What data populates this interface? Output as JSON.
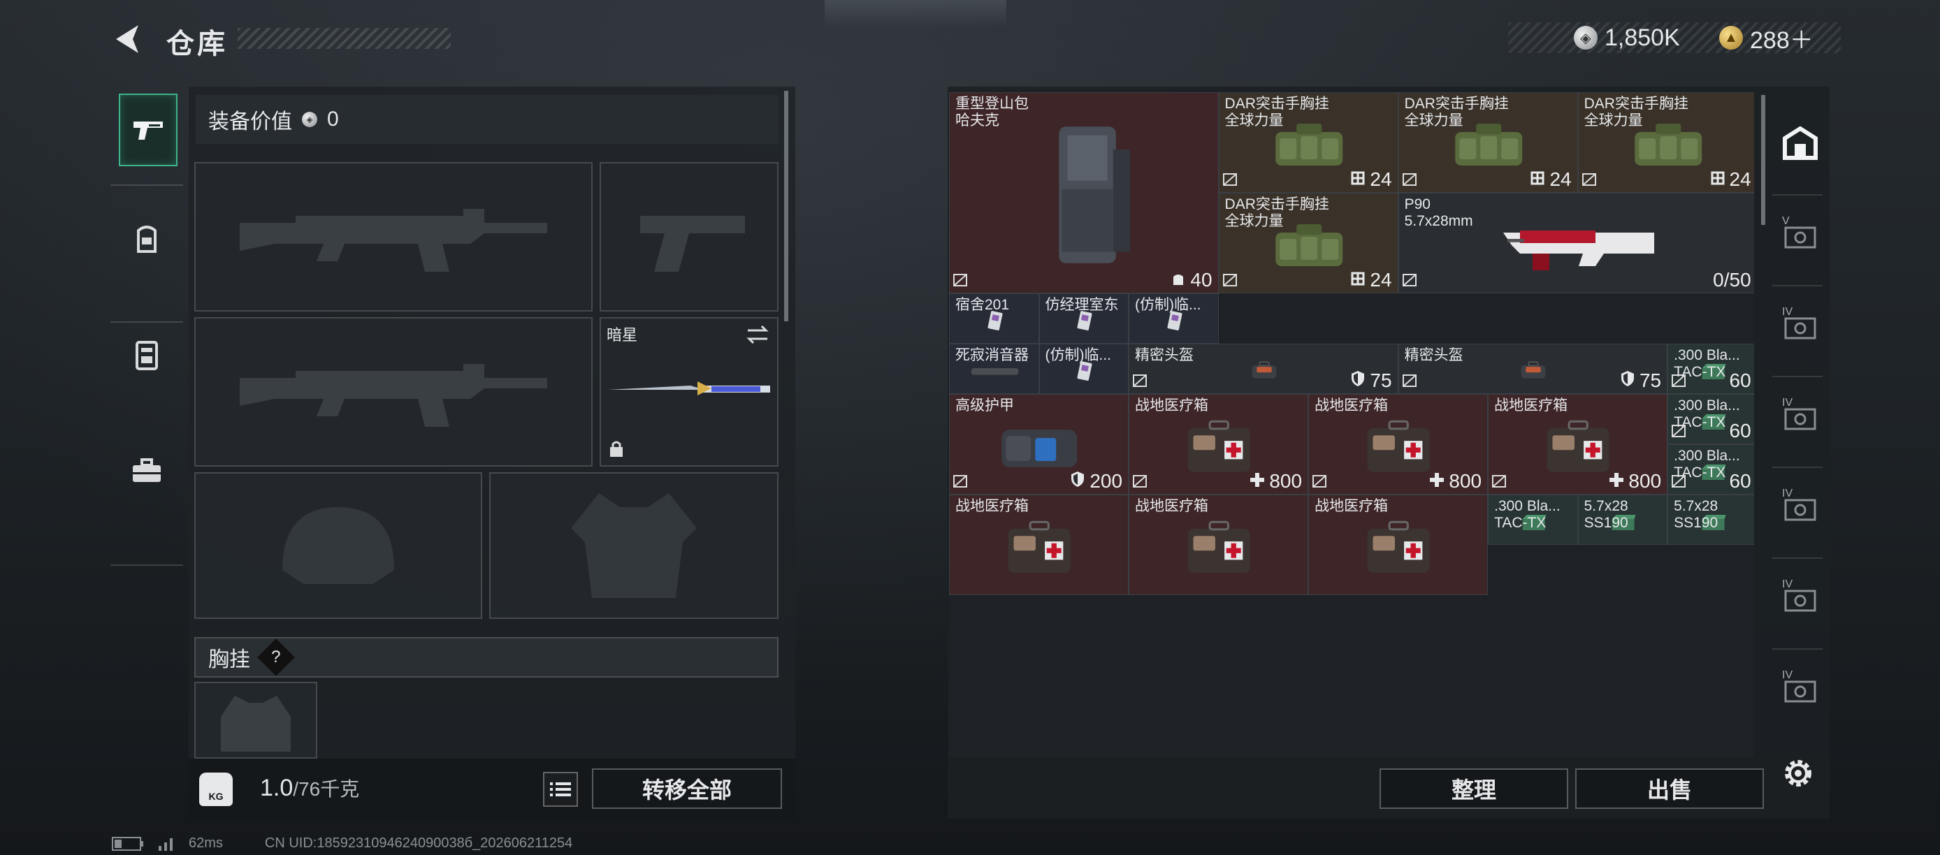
{
  "header": {
    "title": "仓库",
    "currency_a": {
      "icon": "silver-coin-icon",
      "value": "1,850K"
    },
    "currency_b": {
      "icon": "gold-coin-icon",
      "value": "288＋"
    }
  },
  "left_rail": {
    "items": [
      {
        "name": "weapon-tab",
        "icon": "pistol-icon",
        "active": true
      },
      {
        "name": "armor-tab",
        "icon": "backpack-icon",
        "active": false
      },
      {
        "name": "vest-tab",
        "icon": "chest-rig-icon",
        "active": false
      },
      {
        "name": "case-tab",
        "icon": "toolbox-icon",
        "active": false
      }
    ]
  },
  "loadout": {
    "equip_value_label": "装备价值",
    "equip_value": "0",
    "melee_label": "暗星",
    "chest_rig_label": "胸挂",
    "help_mark": "?",
    "weight_icon_text": "KG",
    "weight_value": "1.0",
    "weight_max": "/76千克",
    "transfer_all": "转移全部"
  },
  "stash": {
    "items": [
      {
        "name": "重型登山包\n哈夫克",
        "count": "40",
        "count_icon": "capacity-icon",
        "color": "red"
      },
      {
        "name": "DAR突击手胸挂\n全球力量",
        "count": "24",
        "count_icon": "grid-icon",
        "color": "brown"
      },
      {
        "name": "DAR突击手胸挂\n全球力量",
        "count": "24",
        "count_icon": "grid-icon",
        "color": "brown"
      },
      {
        "name": "DAR突击手胸挂\n全球力量",
        "count": "24",
        "count_icon": "grid-icon",
        "color": "brown"
      },
      {
        "name": "DAR突击手胸挂\n全球力量",
        "count": "24",
        "count_icon": "grid-icon",
        "color": "brown"
      },
      {
        "name": "P90\n5.7x28mm",
        "count": "0/50",
        "count_icon": "",
        "color": "dark"
      },
      {
        "name": "宿舍201",
        "count": "",
        "count_icon": "",
        "color": "blue"
      },
      {
        "name": "仿经理室东",
        "count": "",
        "count_icon": "",
        "color": "blue"
      },
      {
        "name": "(仿制)临...",
        "count": "",
        "count_icon": "",
        "color": "blue"
      },
      {
        "name": "死寂消音器",
        "count": "",
        "count_icon": "",
        "color": "blue"
      },
      {
        "name": "(仿制)临...",
        "count": "",
        "count_icon": "",
        "color": "blue"
      },
      {
        "name": "精密头盔",
        "count": "75",
        "count_icon": "shield-icon",
        "color": "dark"
      },
      {
        "name": "精密头盔",
        "count": "75",
        "count_icon": "shield-icon",
        "color": "dark"
      },
      {
        "name": ".300 Bla...\nTAC-TX",
        "count": "60",
        "count_icon": "",
        "color": "teal"
      },
      {
        "name": "高级护甲",
        "count": "200",
        "count_icon": "shield-icon",
        "color": "red"
      },
      {
        "name": "战地医疗箱",
        "count": "800",
        "count_icon": "plus-icon",
        "color": "red"
      },
      {
        "name": "战地医疗箱",
        "count": "800",
        "count_icon": "plus-icon",
        "color": "red"
      },
      {
        "name": "战地医疗箱",
        "count": "800",
        "count_icon": "plus-icon",
        "color": "red"
      },
      {
        "name": ".300 Bla...\nTAC-TX",
        "count": "60",
        "count_icon": "",
        "color": "teal"
      },
      {
        "name": ".300 Bla...\nTAC-TX",
        "count": "60",
        "count_icon": "",
        "color": "teal"
      },
      {
        "name": "战地医疗箱",
        "count": "",
        "count_icon": "",
        "color": "red"
      },
      {
        "name": "战地医疗箱",
        "count": "",
        "count_icon": "",
        "color": "red"
      },
      {
        "name": "战地医疗箱",
        "count": "",
        "count_icon": "",
        "color": "red"
      },
      {
        "name": ".300 Bla...\nTAC-TX",
        "count": "",
        "count_icon": "",
        "color": "teal"
      },
      {
        "name": "5.7x28\nSS190",
        "count": "",
        "count_icon": "",
        "color": "teal"
      },
      {
        "name": "5.7x28\nSS190",
        "count": "",
        "count_icon": "",
        "color": "teal"
      }
    ],
    "sort_label": "整理",
    "sell_label": "出售"
  },
  "side_tabs": [
    {
      "name": "stash-home-tab",
      "icon": "home-icon",
      "label": ""
    },
    {
      "name": "stash-tab-v",
      "icon": "stash-page-icon",
      "label": "V"
    },
    {
      "name": "stash-tab-iv-1",
      "icon": "stash-page-icon",
      "label": "IV"
    },
    {
      "name": "stash-tab-iv-2",
      "icon": "stash-page-icon",
      "label": "IV"
    },
    {
      "name": "stash-tab-iv-3",
      "icon": "stash-page-icon",
      "label": "IV"
    },
    {
      "name": "stash-tab-iv-4",
      "icon": "stash-page-icon",
      "label": "IV"
    },
    {
      "name": "stash-tab-iv-5",
      "icon": "stash-page-icon",
      "label": "IV"
    }
  ],
  "status_bar": {
    "ping": "62ms",
    "uid": "CN UID:1859231094624090038б_202606211254"
  }
}
